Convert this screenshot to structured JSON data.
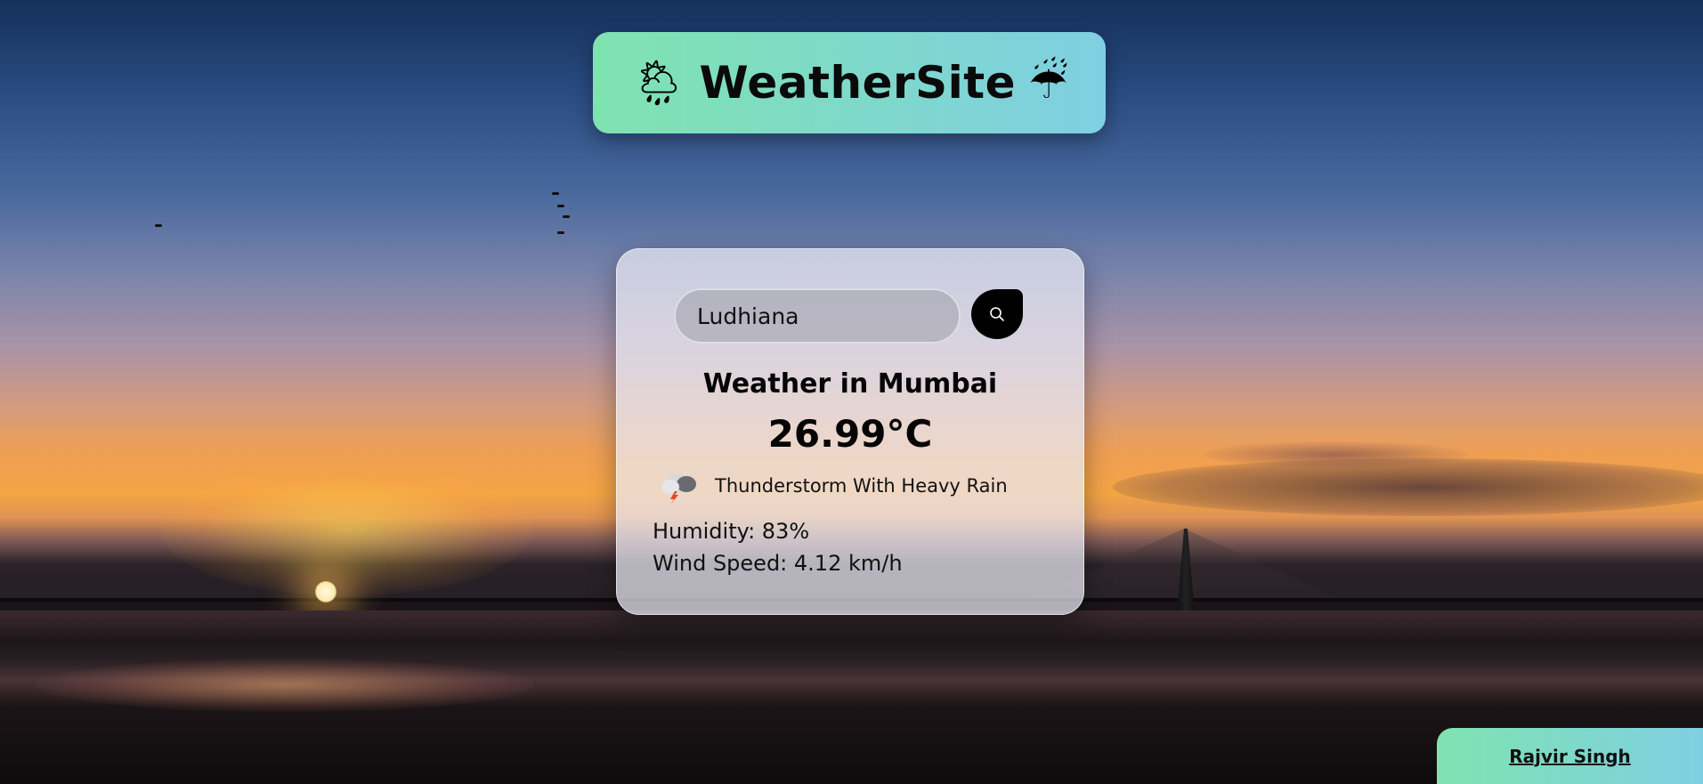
{
  "header": {
    "title": "WeatherSite",
    "left_icon": "sun-behind-rain-cloud-icon",
    "right_icon": "umbrella-with-rain-icon"
  },
  "search": {
    "value": "Ludhiana",
    "button_icon": "search-icon"
  },
  "weather": {
    "title": "Weather in Mumbai",
    "temperature": "26.99°C",
    "condition_icon": "thunderstorm-cloud-icon",
    "condition": "Thunderstorm With Heavy Rain",
    "humidity": "Humidity: 83%",
    "wind_speed": "Wind Speed: 4.12 km/h"
  },
  "footer": {
    "author": "Rajvir Singh"
  },
  "colors": {
    "accent_gradient_start": "#7fe3b0",
    "accent_gradient_end": "#7fcfe2",
    "search_button": "#000000"
  }
}
